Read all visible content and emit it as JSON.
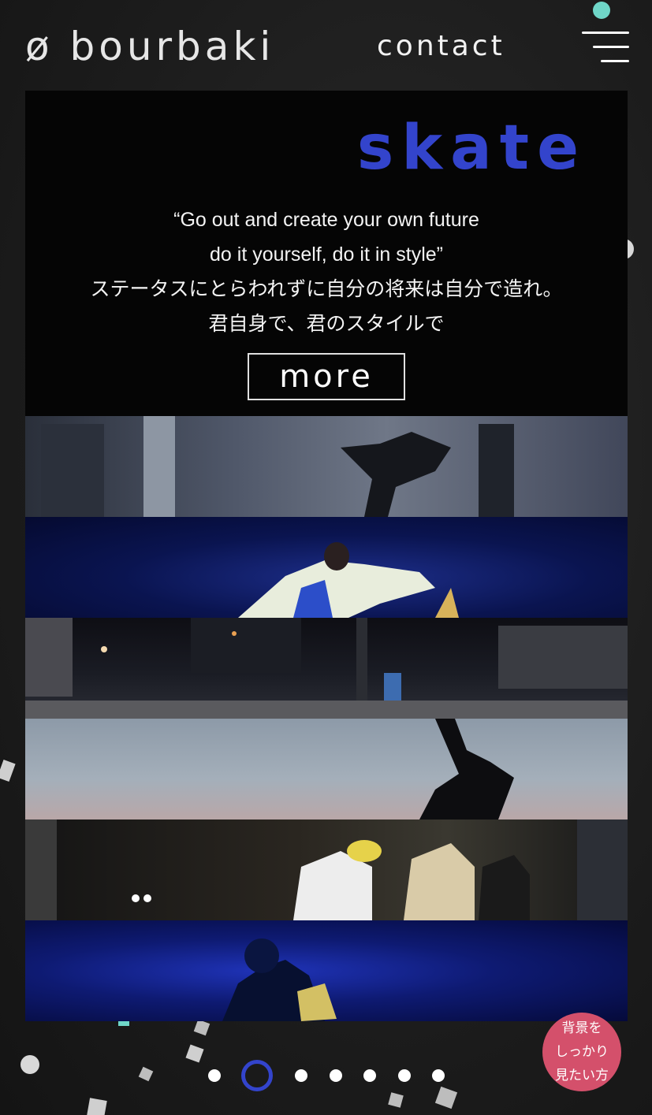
{
  "header": {
    "logo": "ø bourbaki",
    "contact": "contact",
    "menu_icon": "hamburger-menu-icon"
  },
  "card": {
    "title": "skate",
    "quote_lines": [
      "“Go out and create your own future",
      "do it yourself, do it in style”",
      "ステータスにとらわれずに自分の将来は自分で造れ。",
      "君自身で、君のスタイルで"
    ],
    "more": "more"
  },
  "pagination": {
    "count": 7,
    "active_index": 1
  },
  "bg_button": {
    "lines": [
      "背景を",
      "しっかり",
      "見たい方"
    ]
  },
  "colors": {
    "accent": "#3344cc",
    "bg_button": "#d4506b",
    "background": "#1c1c1c"
  }
}
